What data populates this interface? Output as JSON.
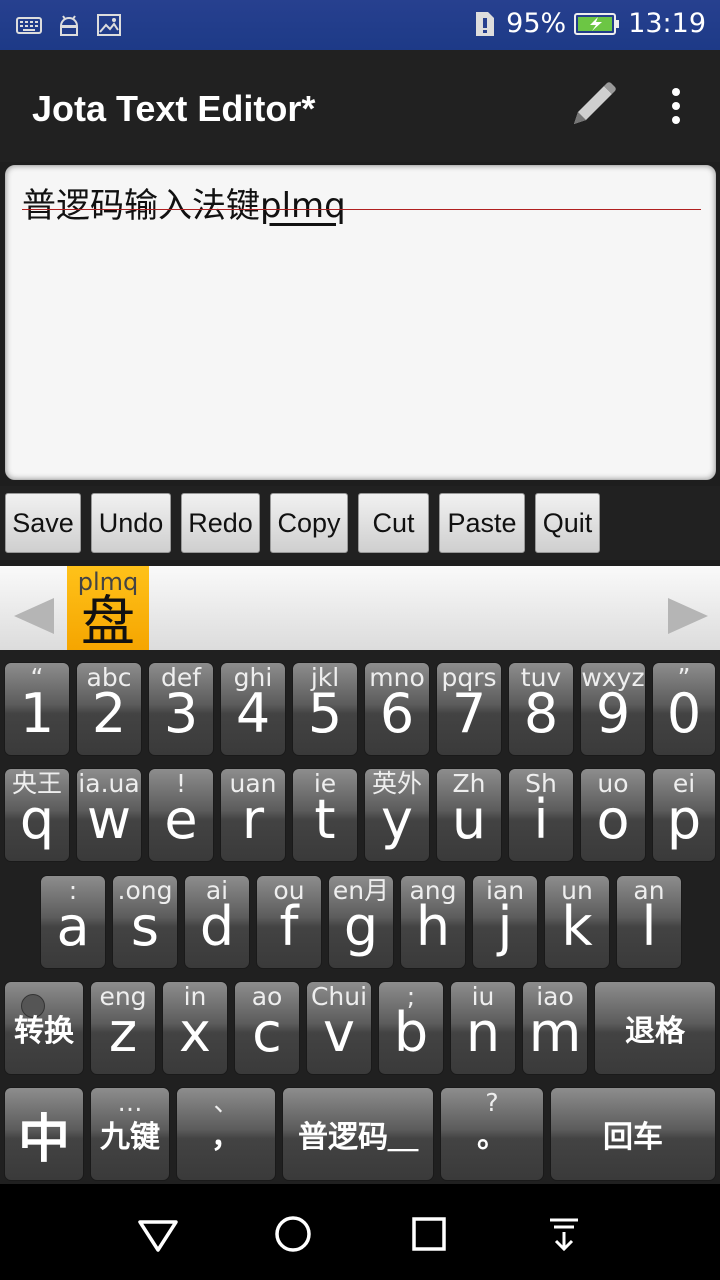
{
  "status_bar": {
    "icons_left": [
      "keyboard-icon",
      "android-icon",
      "image-icon"
    ],
    "battery": "95%",
    "time": "13:19"
  },
  "app_bar": {
    "title": "Jota Text Editor*",
    "actions": [
      "pencil-icon",
      "overflow-menu-icon"
    ]
  },
  "editor": {
    "committed_text": "普逻码输入法键",
    "composing_text": "plmq"
  },
  "toolbar": {
    "buttons": [
      "Save",
      "Undo",
      "Redo",
      "Copy",
      "Cut",
      "Paste",
      "Quit"
    ]
  },
  "candidates": {
    "pinyin": "plmq",
    "character": "盘"
  },
  "keyboard": {
    "rows": [
      [
        {
          "hint": "“",
          "main": "1"
        },
        {
          "hint": "abc",
          "main": "2"
        },
        {
          "hint": "def",
          "main": "3"
        },
        {
          "hint": "ghi",
          "main": "4"
        },
        {
          "hint": "jkl",
          "main": "5"
        },
        {
          "hint": "mno",
          "main": "6"
        },
        {
          "hint": "pqrs",
          "main": "7"
        },
        {
          "hint": "tuv",
          "main": "8"
        },
        {
          "hint": "wxyz",
          "main": "9"
        },
        {
          "hint": "”",
          "main": "0"
        }
      ],
      [
        {
          "hint": "央王",
          "main": "q"
        },
        {
          "hint": "ia.ua",
          "main": "w"
        },
        {
          "hint": "!",
          "main": "e"
        },
        {
          "hint": "uan",
          "main": "r"
        },
        {
          "hint": "ie",
          "main": "t"
        },
        {
          "hint": "英外",
          "main": "y"
        },
        {
          "hint": "Zh",
          "main": "u"
        },
        {
          "hint": "Sh",
          "main": "i"
        },
        {
          "hint": "uo",
          "main": "o"
        },
        {
          "hint": "ei",
          "main": "p"
        }
      ],
      [
        {
          "hint": ":",
          "main": "a"
        },
        {
          "hint": ".ong",
          "main": "s"
        },
        {
          "hint": "ai",
          "main": "d"
        },
        {
          "hint": "ou",
          "main": "f"
        },
        {
          "hint": "en月",
          "main": "g"
        },
        {
          "hint": "ang",
          "main": "h"
        },
        {
          "hint": "ian",
          "main": "j"
        },
        {
          "hint": "un",
          "main": "k"
        },
        {
          "hint": "an",
          "main": "l"
        }
      ],
      [
        {
          "hint": "",
          "main": "转换"
        },
        {
          "hint": "eng",
          "main": "z"
        },
        {
          "hint": "in",
          "main": "x"
        },
        {
          "hint": "ao",
          "main": "c"
        },
        {
          "hint": "Chui",
          "main": "v"
        },
        {
          "hint": ";",
          "main": "b"
        },
        {
          "hint": "iu",
          "main": "n"
        },
        {
          "hint": "iao",
          "main": "m"
        },
        {
          "hint": "",
          "main": "退格"
        }
      ],
      [
        {
          "hint": "",
          "main": "中"
        },
        {
          "hint": "…",
          "main": "九键"
        },
        {
          "hint": "、",
          "main": "，"
        },
        {
          "hint": "",
          "main": "普逻码＿"
        },
        {
          "hint": "?",
          "main": "。"
        },
        {
          "hint": "",
          "main": "回车"
        }
      ]
    ]
  },
  "nav_bar": {
    "buttons": [
      "back-icon",
      "home-icon",
      "recents-icon",
      "hide-keyboard-icon"
    ]
  }
}
